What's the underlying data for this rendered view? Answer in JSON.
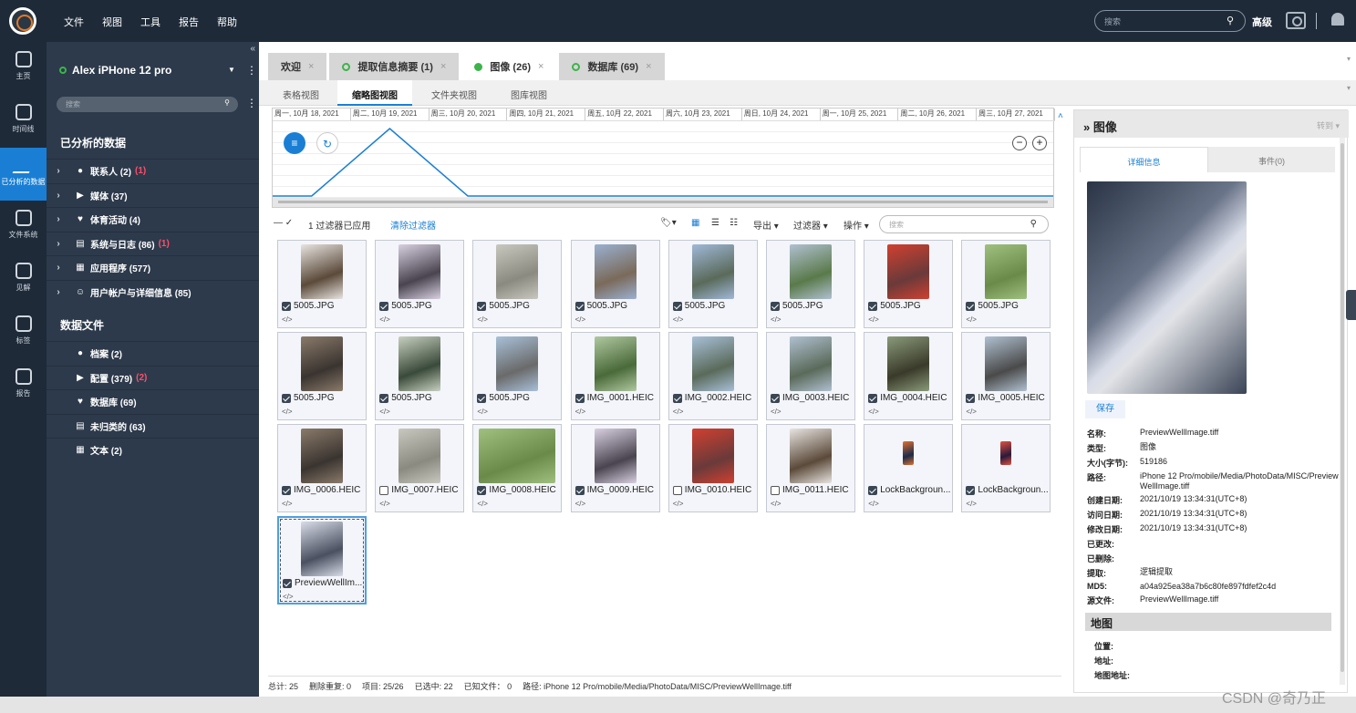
{
  "menu": [
    "文件",
    "视图",
    "工具",
    "报告",
    "帮助"
  ],
  "top": {
    "search_placeholder": "搜索",
    "advanced": "高级"
  },
  "rail": [
    {
      "label": "主页",
      "icon": "home-icon"
    },
    {
      "label": "时间线",
      "icon": "clock-icon"
    },
    {
      "label": "已分析的数据",
      "icon": "activity-icon",
      "active": true
    },
    {
      "label": "文件系统",
      "icon": "folder-tree-icon"
    },
    {
      "label": "见解",
      "icon": "lightbulb-icon"
    },
    {
      "label": "标签",
      "icon": "tag-icon"
    },
    {
      "label": "报告",
      "icon": "report-icon"
    }
  ],
  "sidebar": {
    "device": "Alex iPHone 12 pro",
    "search_placeholder": "搜索",
    "analyzed_title": "已分析的数据",
    "analyzed": [
      {
        "label": "联系人 (2)",
        "extra": "(1)"
      },
      {
        "label": "媒体 (37)",
        "extra": ""
      },
      {
        "label": "体育活动 (4)",
        "extra": ""
      },
      {
        "label": "系统与日志 (86)",
        "extra": "(1)"
      },
      {
        "label": "应用程序 (577)",
        "extra": ""
      },
      {
        "label": "用户帐户与详细信息 (85)",
        "extra": ""
      }
    ],
    "files_title": "数据文件",
    "files": [
      {
        "label": "档案 (2)",
        "extra": ""
      },
      {
        "label": "配置 (379)",
        "extra": "(2)"
      },
      {
        "label": "数据库 (69)",
        "extra": ""
      },
      {
        "label": "未归类的 (63)",
        "extra": ""
      },
      {
        "label": "文本 (2)",
        "extra": ""
      }
    ]
  },
  "tabs": [
    {
      "label": "欢迎",
      "ring": "none"
    },
    {
      "label": "提取信息摘要 (1)",
      "ring": "ring"
    },
    {
      "label": "图像 (26)",
      "ring": "filled",
      "active": true
    },
    {
      "label": "数据库 (69)",
      "ring": "ring"
    }
  ],
  "subtabs": [
    {
      "label": "表格视图"
    },
    {
      "label": "缩略图视图",
      "active": true
    },
    {
      "label": "文件夹视图"
    },
    {
      "label": "图库视图"
    }
  ],
  "timeline": {
    "dates": [
      "周一, 10月 18, 2021",
      "周二, 10月 19, 2021",
      "周三, 10月 20, 2021",
      "周四, 10月 21, 2021",
      "周五, 10月 22, 2021",
      "周六, 10月 23, 2021",
      "周日, 10月 24, 2021",
      "周一, 10月 25, 2021",
      "周二, 10月 26, 2021",
      "周三, 10月 27, 2021"
    ],
    "counts": [
      0,
      25,
      0,
      0,
      0,
      0,
      0,
      0,
      0,
      0
    ]
  },
  "toolbar": {
    "filter_applied": "1 过滤器已应用",
    "clear_filter": "清除过滤器",
    "export": "导出",
    "filters": "过滤器",
    "actions": "操作",
    "search_placeholder": "搜索"
  },
  "images": [
    {
      "name": "5005.JPG",
      "checked": true,
      "c1": "#5b4a3a",
      "c2": "#e8e4e0"
    },
    {
      "name": "5005.JPG",
      "checked": true,
      "c1": "#4a4450",
      "c2": "#d8d0e0"
    },
    {
      "name": "5005.JPG",
      "checked": true,
      "c1": "#8a8a80",
      "c2": "#c8c8c0"
    },
    {
      "name": "5005.JPG",
      "checked": true,
      "c1": "#7a6a5a",
      "c2": "#9ab0d0"
    },
    {
      "name": "5005.JPG",
      "checked": true,
      "c1": "#5a6a5a",
      "c2": "#a0b8d8"
    },
    {
      "name": "5005.JPG",
      "checked": true,
      "c1": "#5a7a4a",
      "c2": "#b0c0d0"
    },
    {
      "name": "5005.JPG",
      "checked": true,
      "c1": "#6a3a3a",
      "c2": "#d04030"
    },
    {
      "name": "5005.JPG",
      "checked": true,
      "c1": "#6a8a4a",
      "c2": "#a0c080"
    },
    {
      "name": "5005.JPG",
      "checked": true,
      "c1": "#3a3430",
      "c2": "#8a7a6a"
    },
    {
      "name": "5005.JPG",
      "checked": true,
      "c1": "#3a4a3a",
      "c2": "#c8d0c0"
    },
    {
      "name": "5005.JPG",
      "checked": true,
      "c1": "#6a6a6a",
      "c2": "#a8c0d8"
    },
    {
      "name": "IMG_0001.HEIC",
      "checked": true,
      "c1": "#4a6a3a",
      "c2": "#b0c8a0"
    },
    {
      "name": "IMG_0002.HEIC",
      "checked": true,
      "c1": "#5a6a5a",
      "c2": "#a8c0d8"
    },
    {
      "name": "IMG_0003.HEIC",
      "checked": true,
      "c1": "#5a6a5a",
      "c2": "#b0c0d0"
    },
    {
      "name": "IMG_0004.HEIC",
      "checked": true,
      "c1": "#3a3a2a",
      "c2": "#8a9a7a"
    },
    {
      "name": "IMG_0005.HEIC",
      "checked": true,
      "c1": "#4a4a4a",
      "c2": "#b0c0d0"
    },
    {
      "name": "IMG_0006.HEIC",
      "checked": true,
      "c1": "#3a3430",
      "c2": "#8a7a6a"
    },
    {
      "name": "IMG_0007.HEIC",
      "checked": false,
      "c1": "#8a8a80",
      "c2": "#c8c8c0"
    },
    {
      "name": "IMG_0008.HEIC",
      "checked": true,
      "c1": "#6a8a4a",
      "c2": "#a0c080",
      "wide": true
    },
    {
      "name": "IMG_0009.HEIC",
      "checked": true,
      "c1": "#4a4450",
      "c2": "#d8d0e0"
    },
    {
      "name": "IMG_0010.HEIC",
      "checked": false,
      "c1": "#6a3a3a",
      "c2": "#d04030"
    },
    {
      "name": "IMG_0011.HEIC",
      "checked": false,
      "c1": "#5b4a3a",
      "c2": "#e8e4e0"
    },
    {
      "name": "LockBackgroun...",
      "checked": true,
      "c1": "#1a2a4a",
      "c2": "#e07030",
      "small": true
    },
    {
      "name": "LockBackgroun...",
      "checked": true,
      "c1": "#2a1a3a",
      "c2": "#e05040",
      "small": true
    },
    {
      "name": "PreviewWellIm...",
      "checked": true,
      "c1": "#4a5060",
      "c2": "#d8dce8",
      "selected": true
    }
  ],
  "status": [
    "总计: 25",
    "删除重复: 0",
    "项目: 25/26",
    "已选中: 22",
    "已知文件： 0",
    "路径: iPhone 12 Pro/mobile/Media/PhotoData/MISC/PreviewWellImage.tiff"
  ],
  "detail": {
    "title": "图像",
    "goto": "转到",
    "tab_info": "详细信息",
    "tab_events": "事件(0)",
    "save": "保存",
    "props": [
      {
        "k": "名称:",
        "v": "PreviewWellImage.tiff"
      },
      {
        "k": "类型:",
        "v": "图像"
      },
      {
        "k": "大小(字节):",
        "v": "519186"
      },
      {
        "k": "路径:",
        "v": "iPhone 12 Pro/mobile/Media/PhotoData/MISC/PreviewWellImage.tiff"
      },
      {
        "k": "创建日期:",
        "v": "2021/10/19 13:34:31(UTC+8)"
      },
      {
        "k": "访问日期:",
        "v": "2021/10/19 13:34:31(UTC+8)"
      },
      {
        "k": "修改日期:",
        "v": "2021/10/19 13:34:31(UTC+8)"
      },
      {
        "k": "已更改:",
        "v": ""
      },
      {
        "k": "已删除:",
        "v": ""
      },
      {
        "k": "提取:",
        "v": "逻辑提取"
      },
      {
        "k": "MD5:",
        "v": "a04a925ea38a7b6c80fe897fdfef2c4d"
      },
      {
        "k": "源文件:",
        "v": "PreviewWellImage.tiff"
      }
    ],
    "map_title": "地图",
    "map_rows": [
      "位置:",
      "地址:",
      "地图地址:"
    ]
  },
  "watermark": "CSDN @奇乃正"
}
